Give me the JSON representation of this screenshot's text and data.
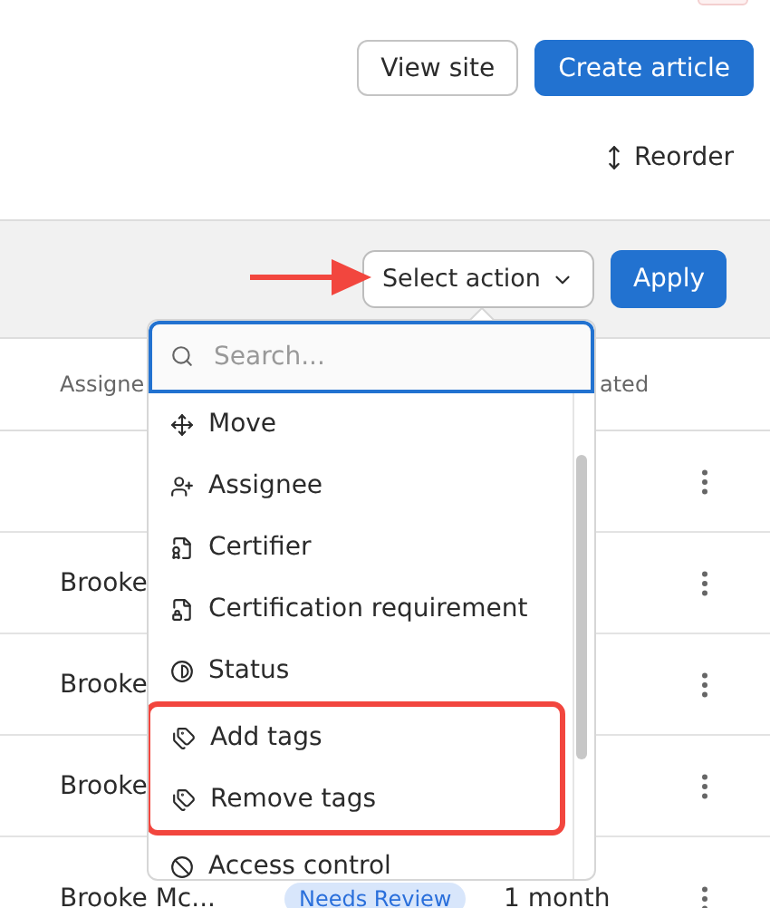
{
  "header_buttons": [
    {
      "label": "View site",
      "kind": "secondary"
    },
    {
      "label": "Create article",
      "kind": "primary"
    }
  ],
  "reorder": {
    "label": "Reorder"
  },
  "bulk_action": {
    "select": {
      "label": "Select action",
      "expanded": true
    },
    "apply": {
      "label": "Apply"
    }
  },
  "table": {
    "columns": [
      "Assigne",
      "ated"
    ],
    "rows": [
      {
        "name": ""
      },
      {
        "name": "Brooke"
      },
      {
        "name": "Brooke"
      },
      {
        "name": "Brooke"
      },
      {
        "name": "Brooke Mc...",
        "status": "Needs Review",
        "date": "1 month"
      }
    ]
  },
  "action_menu": {
    "search": {
      "placeholder": "Search..."
    },
    "items": [
      {
        "label": "Move",
        "annotated": false
      },
      {
        "label": "Assignee",
        "annotated": false
      },
      {
        "label": "Certifier",
        "annotated": false
      },
      {
        "label": "Certification requirement",
        "annotated": false
      },
      {
        "label": "Status",
        "annotated": false
      },
      {
        "label": "Add tags",
        "annotated": true
      },
      {
        "label": "Remove tags",
        "annotated": true
      },
      {
        "label": "Access control",
        "annotated": false
      }
    ]
  }
}
